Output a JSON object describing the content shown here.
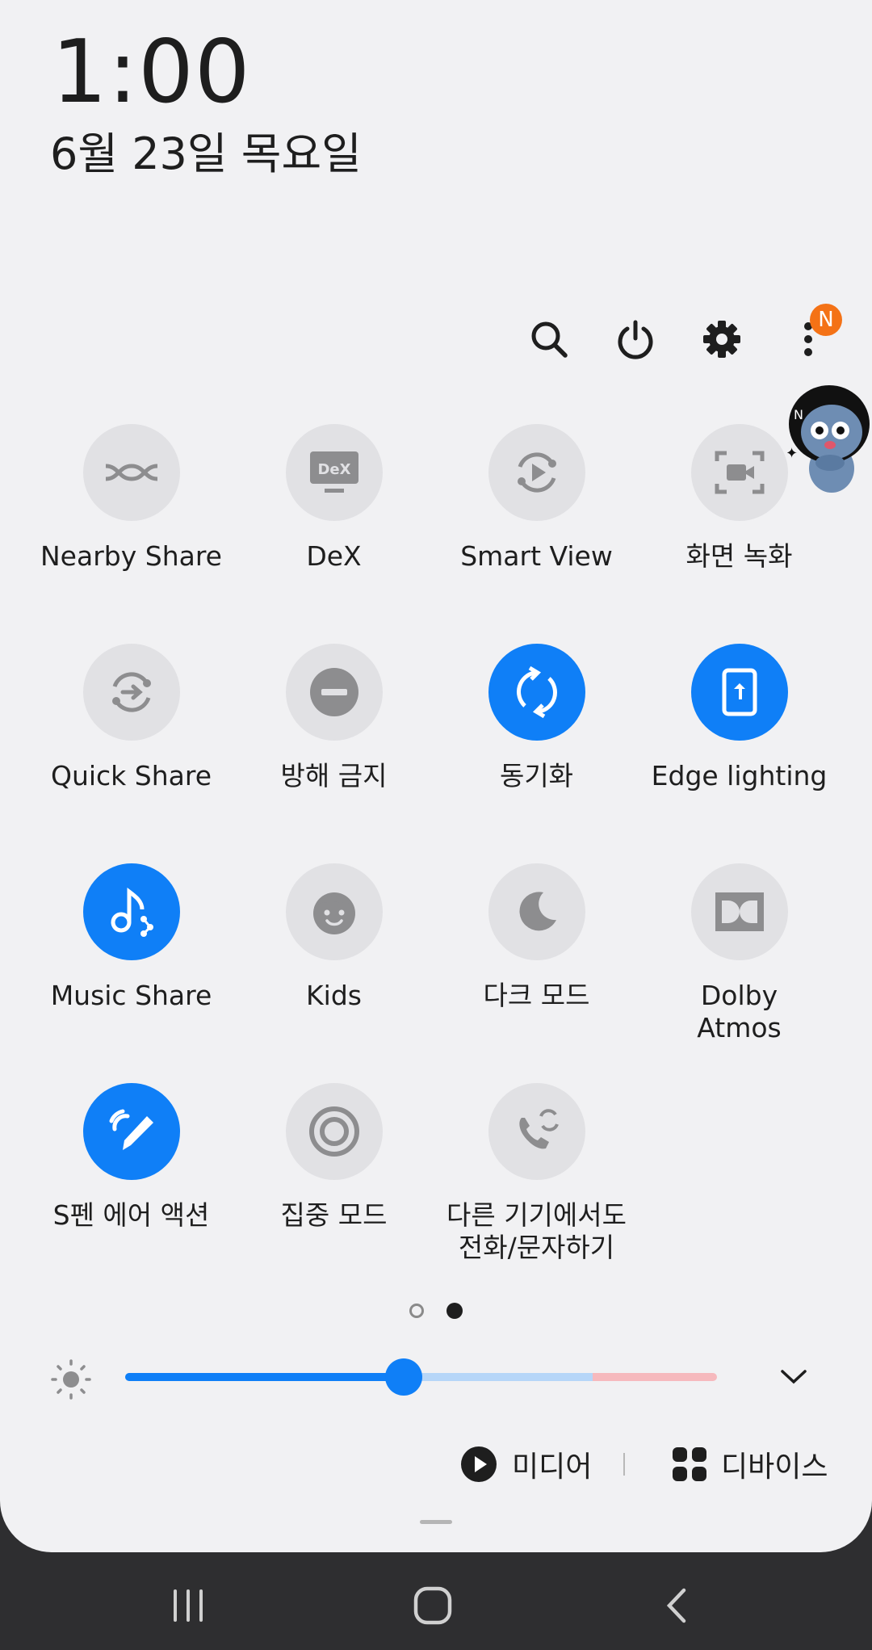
{
  "status": {
    "time": "1:00",
    "date": "6월 23일 목요일"
  },
  "top_actions": {
    "search_icon": "search-icon",
    "power_icon": "power-icon",
    "settings_icon": "gear-icon",
    "more_icon": "more-vertical-icon",
    "notification_badge": "N"
  },
  "tiles": [
    {
      "label": "Nearby Share",
      "icon": "nearby-share-icon",
      "active": false
    },
    {
      "label": "DeX",
      "icon": "dex-icon",
      "active": false
    },
    {
      "label": "Smart View",
      "icon": "smart-view-icon",
      "active": false
    },
    {
      "label": "화면 녹화",
      "icon": "screen-record-icon",
      "active": false
    },
    {
      "label": "Quick Share",
      "icon": "quick-share-icon",
      "active": false
    },
    {
      "label": "방해 금지",
      "icon": "do-not-disturb-icon",
      "active": false
    },
    {
      "label": "동기화",
      "icon": "sync-icon",
      "active": true
    },
    {
      "label": "Edge lighting",
      "icon": "edge-lighting-icon",
      "active": true
    },
    {
      "label": "Music Share",
      "icon": "music-share-icon",
      "active": true
    },
    {
      "label": "Kids",
      "icon": "kids-icon",
      "active": false
    },
    {
      "label": "다크 모드",
      "icon": "dark-mode-icon",
      "active": false
    },
    {
      "label": "Dolby\nAtmos",
      "icon": "dolby-icon",
      "active": false
    },
    {
      "label": "S펜 에어 액션",
      "icon": "spen-air-action-icon",
      "active": true
    },
    {
      "label": "집중 모드",
      "icon": "focus-mode-icon",
      "active": false
    },
    {
      "label": "다른 기기에서도\n전화/문자하기",
      "icon": "call-text-other-devices-icon",
      "active": false
    }
  ],
  "pager": {
    "pages": 2,
    "current": 2
  },
  "brightness": {
    "level": 0.47,
    "icon": "sun-icon",
    "expand_icon": "chevron-down-icon"
  },
  "media_row": {
    "media_label": "미디어",
    "devices_label": "디바이스"
  },
  "colors": {
    "accent": "#0f7ff7",
    "panel": "#f1f1f3",
    "tile_off": "#e1e1e4",
    "badge": "#f47216"
  },
  "nav": {
    "recents_icon": "recents-icon",
    "home_icon": "home-icon",
    "back_icon": "back-icon"
  }
}
